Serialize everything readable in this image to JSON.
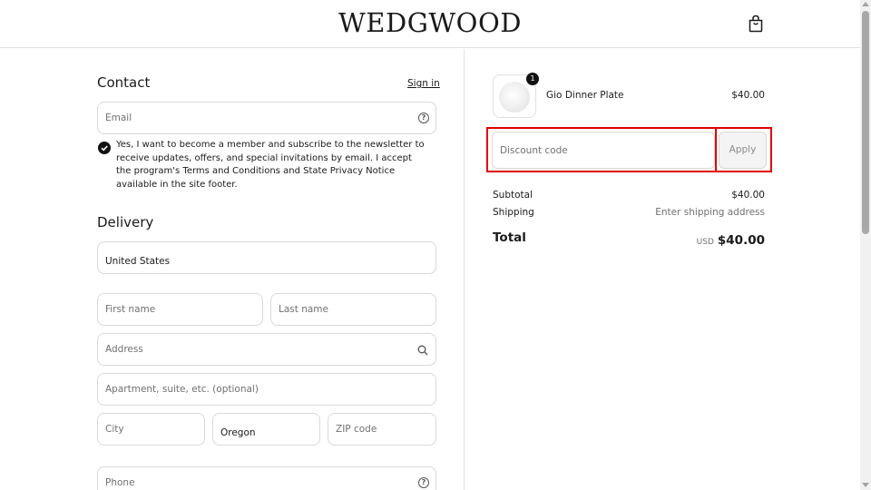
{
  "header": {
    "brand": "WEDGWOOD",
    "cart_icon": "shopping-bag-icon"
  },
  "contact": {
    "title": "Contact",
    "sign_in": "Sign in",
    "email_placeholder": "Email",
    "newsletter_checked": true,
    "newsletter_text": "Yes, I want to become a member and subscribe to the newsletter to receive updates, offers, and special invitations by email. I accept the program's Terms and Conditions and State Privacy Notice available in the site footer."
  },
  "delivery": {
    "title": "Delivery",
    "country": "United States",
    "first_name_placeholder": "First name",
    "last_name_placeholder": "Last name",
    "address_placeholder": "Address",
    "apartment_placeholder": "Apartment, suite, etc. (optional)",
    "city_placeholder": "City",
    "state": "Oregon",
    "zip_placeholder": "ZIP code",
    "phone_placeholder": "Phone"
  },
  "order": {
    "item": {
      "name": "Gio Dinner Plate",
      "price": "$40.00",
      "quantity": "1"
    },
    "discount_placeholder": "Discount code",
    "apply_label": "Apply",
    "subtotal_label": "Subtotal",
    "subtotal_value": "$40.00",
    "shipping_label": "Shipping",
    "shipping_value": "Enter shipping address",
    "total_label": "Total",
    "total_currency": "USD",
    "total_value": "$40.00"
  },
  "colors": {
    "highlight": "#e00000",
    "text": "#1a1a1a",
    "border": "#d9d9d9"
  }
}
